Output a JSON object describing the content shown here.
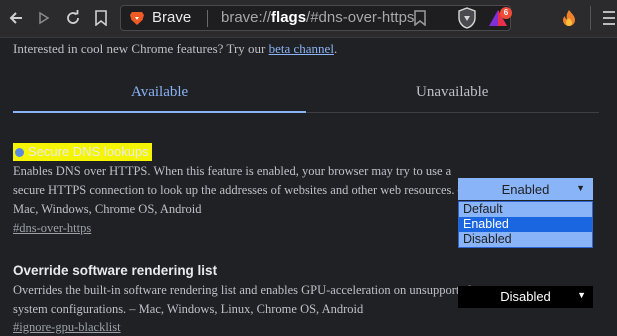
{
  "browser": {
    "brand_label": "Brave",
    "url_prefix": "brave://",
    "url_bold": "flags",
    "url_suffix": "/#dns-over-https",
    "rewards_count": "6"
  },
  "flags_page": {
    "intro_text": "Interested in cool new Chrome features? Try our ",
    "intro_link": "beta channel",
    "intro_end": ".",
    "tabs": [
      {
        "label": "Available",
        "active": true
      },
      {
        "label": "Unavailable",
        "active": false
      }
    ],
    "features": [
      {
        "title": "Secure DNS lookups",
        "description_lines": [
          "Enables DNS over HTTPS. When this feature is enabled, your browser may try to use a",
          "secure HTTPS connection to look up the addresses of websites and other web resources. –",
          "Mac, Windows, Chrome OS, Android"
        ],
        "hash": "#dns-over-https",
        "selected": "Enabled",
        "dropdown_open": true,
        "options": [
          "Default",
          "Enabled",
          "Disabled"
        ],
        "highlighted_option": "Enabled"
      },
      {
        "title": "Override software rendering list",
        "description_lines": [
          "Overrides the built-in software rendering list and enables GPU-acceleration on unsupported",
          "system configurations. – Mac, Windows, Linux, Chrome OS, Android"
        ],
        "hash": "#ignore-gpu-blacklist",
        "selected": "Disabled",
        "dropdown_open": false
      }
    ]
  },
  "colors": {
    "accent": "#8ab4f8",
    "highlight": "#f5f500",
    "background": "#202124"
  }
}
